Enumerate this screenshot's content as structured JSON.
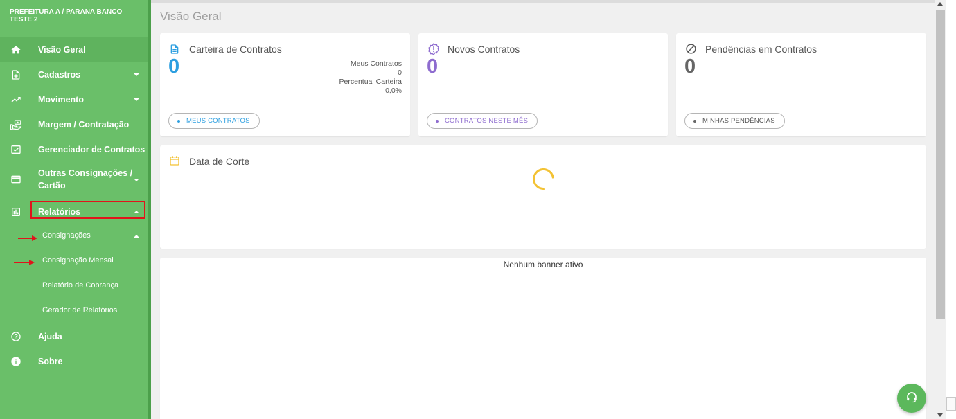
{
  "org": {
    "title": "PREFEITURA A / PARANA BANCO TESTE 2"
  },
  "sidebar": {
    "items": [
      {
        "label": "Visão Geral",
        "icon": "home-icon"
      },
      {
        "label": "Cadastros",
        "icon": "add-document-icon"
      },
      {
        "label": "Movimento",
        "icon": "trending-up-icon"
      },
      {
        "label": "Margem / Contratação",
        "icon": "money-hand-icon"
      },
      {
        "label": "Gerenciador de Contratos",
        "icon": "checklist-icon"
      },
      {
        "label": "Outras Consignações / Cartão",
        "icon": "credit-card-icon"
      },
      {
        "label": "Relatórios",
        "icon": "bar-chart-icon"
      },
      {
        "label": "Ajuda",
        "icon": "help-circle-icon"
      },
      {
        "label": "Sobre",
        "icon": "info-icon"
      }
    ],
    "subitems": [
      {
        "label": "Consignações"
      },
      {
        "label": "Consignação Mensal"
      },
      {
        "label": "Relatório de Cobrança"
      },
      {
        "label": "Gerador de Relatórios"
      }
    ]
  },
  "page": {
    "title": "Visão Geral"
  },
  "cards": {
    "carteira": {
      "title": "Carteira de Contratos",
      "count": "0",
      "stat1_label": "Meus Contratos",
      "stat1_value": "0",
      "stat2_label": "Percentual Carteira",
      "stat2_value": "0,0%",
      "button": "MEUS CONTRATOS",
      "color": "#2d9fe0"
    },
    "novos": {
      "title": "Novos Contratos",
      "count": "0",
      "button": "CONTRATOS NESTE MÊS",
      "color": "#8e6ccf"
    },
    "pendencias": {
      "title": "Pendências em Contratos",
      "count": "0",
      "button": "MINHAS PENDÊNCIAS",
      "color": "#666666"
    },
    "corte": {
      "title": "Data de Corte",
      "color": "#f3c233"
    }
  },
  "banner": {
    "text": "Nenhum banner ativo"
  }
}
